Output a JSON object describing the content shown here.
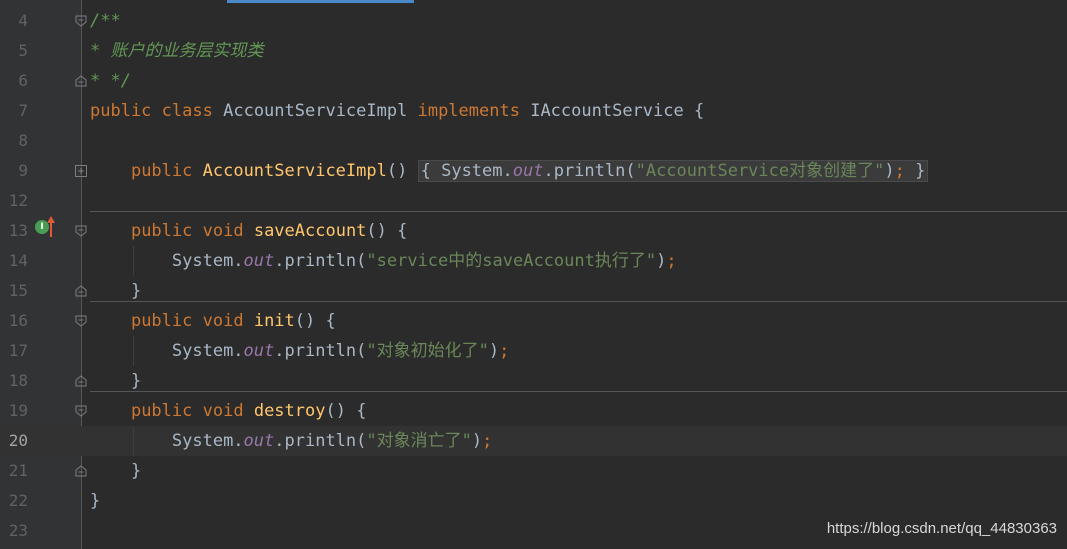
{
  "watermark": "https://blog.csdn.net/qq_44830363",
  "lines": [
    {
      "num": "4"
    },
    {
      "num": "5"
    },
    {
      "num": "6"
    },
    {
      "num": "7"
    },
    {
      "num": "8"
    },
    {
      "num": "9"
    },
    {
      "num": "12"
    },
    {
      "num": "13"
    },
    {
      "num": "14"
    },
    {
      "num": "15"
    },
    {
      "num": "16"
    },
    {
      "num": "17"
    },
    {
      "num": "18"
    },
    {
      "num": "19"
    },
    {
      "num": "20"
    },
    {
      "num": "21"
    },
    {
      "num": "22"
    },
    {
      "num": "23"
    }
  ],
  "code": {
    "l4_comment_open": "/**",
    "l5_comment": "* 账户的业务层实现类",
    "l6_comment_close": "* */",
    "kw_public": "public",
    "kw_class": "class",
    "kw_implements": "implements",
    "kw_void": "void",
    "class_name": "AccountServiceImpl",
    "interface_name": "IAccountService",
    "open_brace": "{",
    "close_brace": "}",
    "constructor_name": "AccountServiceImpl",
    "parens": "()",
    "system": "System.",
    "out": "out",
    "println": ".println(",
    "str_constructor": "\"AccountService对象创建了\"",
    "str_save": "\"service中的saveAccount执行了\"",
    "str_init": "\"对象初始化了\"",
    "str_destroy": "\"对象消亡了\"",
    "close_call": ")",
    "semicolon": ";",
    "method_save": "saveAccount",
    "method_init": "init",
    "method_destroy": "destroy",
    "implements_badge": "I"
  },
  "colors": {
    "background": "#2b2b2b",
    "gutter": "#313335",
    "keyword": "#cc7832",
    "method": "#ffc66d",
    "string": "#6a8759",
    "field": "#9876aa",
    "comment": "#629755",
    "text": "#a9b7c6"
  }
}
